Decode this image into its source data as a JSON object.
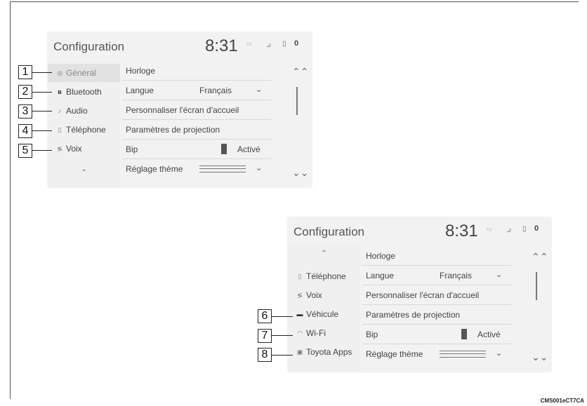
{
  "screen1": {
    "header": {
      "title": "Configuration",
      "time": "8:31",
      "indicator": "▭",
      "signal": "⊿",
      "battery": "▯",
      "status_icon": "0"
    },
    "sidebar": [
      {
        "label": "Général",
        "icon": "gear-icon"
      },
      {
        "label": "Bluetooth",
        "icon": "bluetooth-icon"
      },
      {
        "label": "Audio",
        "icon": "music-note-icon"
      },
      {
        "label": "Téléphone",
        "icon": "phone-icon"
      },
      {
        "label": "Voix",
        "icon": "voice-icon"
      }
    ],
    "sidebar_more": "⌄",
    "rows": [
      {
        "label": "Horloge"
      },
      {
        "label": "Langue",
        "value": "Français",
        "chevron": "⌄"
      },
      {
        "label": "Personnaliser l'écran d'accueil"
      },
      {
        "label": "Paramètres de projection"
      },
      {
        "label": "Bip",
        "toggle": "Activé"
      },
      {
        "label": "Réglage thème",
        "chevron": "⌄"
      }
    ],
    "scroll_up": "⌃⌃",
    "scroll_down": "⌄⌄",
    "callouts": [
      "1",
      "2",
      "3",
      "4",
      "5"
    ]
  },
  "screen2": {
    "header": {
      "title": "Configuration",
      "time": "8:31",
      "indicator": "▭",
      "signal": "⊿",
      "battery": "▯",
      "status_icon": "0"
    },
    "sidebar_up": "⌃",
    "sidebar": [
      {
        "label": "Téléphone",
        "icon": "phone-icon"
      },
      {
        "label": "Voix",
        "icon": "voice-icon"
      },
      {
        "label": "Véhicule",
        "icon": "car-icon"
      },
      {
        "label": "Wi-Fi",
        "icon": "wifi-icon"
      },
      {
        "label": "Toyota Apps",
        "icon": "apps-icon"
      }
    ],
    "rows": [
      {
        "label": "Horloge"
      },
      {
        "label": "Langue",
        "value": "Français",
        "chevron": "⌄"
      },
      {
        "label": "Personnaliser l'écran d'accueil"
      },
      {
        "label": "Paramètres de projection"
      },
      {
        "label": "Bip",
        "toggle": "Activé"
      },
      {
        "label": "Réglage thème",
        "chevron": "⌄"
      }
    ],
    "scroll_up": "⌃⌃",
    "scroll_down": "⌄⌄",
    "callouts": [
      "6",
      "7",
      "8"
    ]
  },
  "figure_code": "CMS001eCT7CA"
}
